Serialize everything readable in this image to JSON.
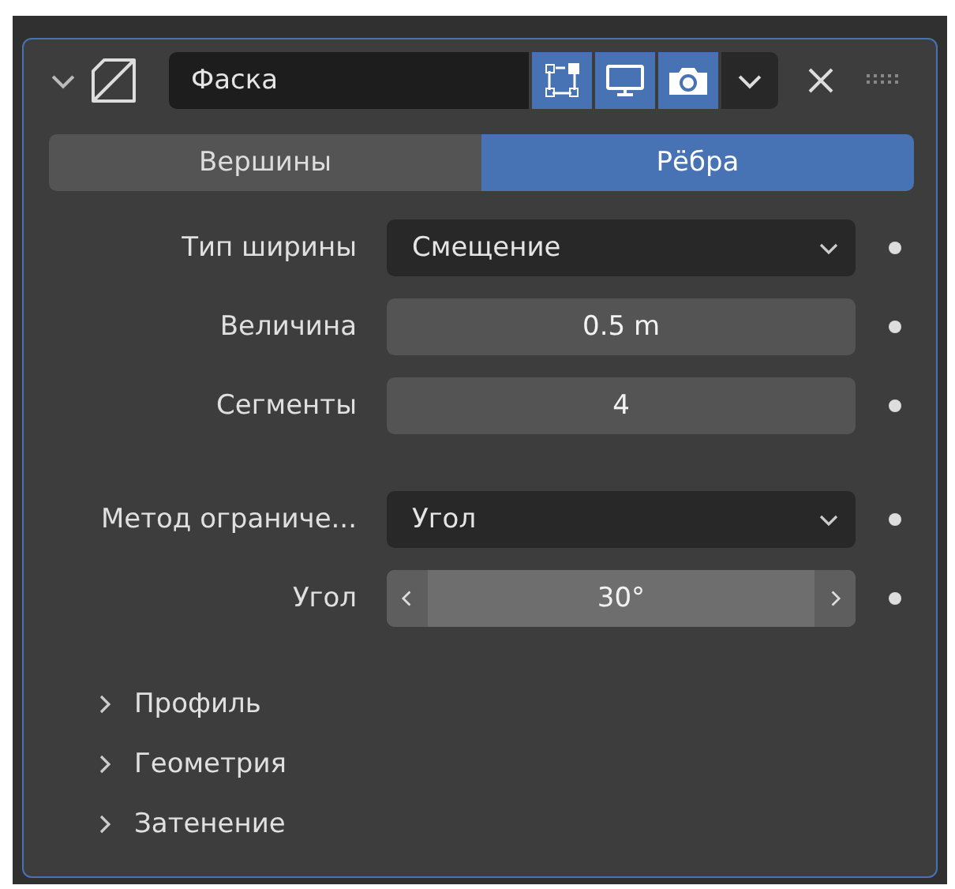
{
  "header": {
    "expanded": true,
    "name": "Фаска",
    "toggles": [
      {
        "kind": "editmode",
        "on": true
      },
      {
        "kind": "viewport",
        "on": true
      },
      {
        "kind": "render",
        "on": true
      }
    ]
  },
  "tabs": [
    {
      "label": "Вершины",
      "selected": false
    },
    {
      "label": "Рёбра",
      "selected": true
    }
  ],
  "groups": [
    [
      {
        "label": "Тип ширины",
        "kind": "dropdown",
        "value": "Смещение",
        "hovered": false
      },
      {
        "label": "Величина",
        "kind": "number",
        "value": "0.5 m",
        "hovered": false
      },
      {
        "label": "Сегменты",
        "kind": "number",
        "value": "4",
        "hovered": false
      }
    ],
    [
      {
        "label": "Метод ограниче...",
        "kind": "dropdown",
        "value": "Угол",
        "hovered": false
      },
      {
        "label": "Угол",
        "kind": "number",
        "value": "30°",
        "hovered": true
      }
    ]
  ],
  "subpanels": [
    {
      "label": "Профиль",
      "expanded": false
    },
    {
      "label": "Геометрия",
      "expanded": false
    },
    {
      "label": "Затенение",
      "expanded": false
    }
  ]
}
